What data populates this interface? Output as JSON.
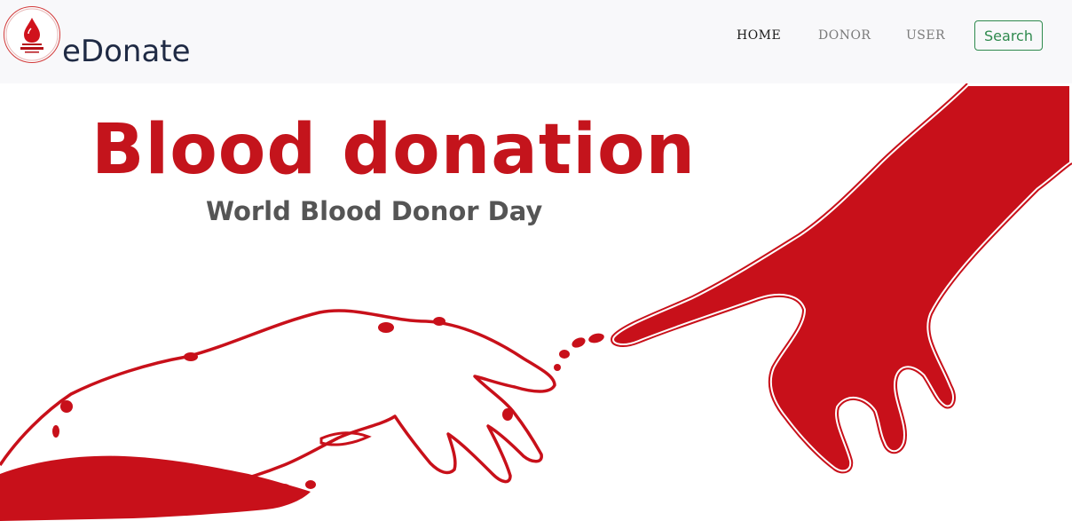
{
  "brand": {
    "name": "eDonate",
    "logo_icon": "blood-drop-logo-icon"
  },
  "nav": {
    "items": [
      {
        "label": "HOME",
        "active": true
      },
      {
        "label": "DONOR",
        "active": false
      },
      {
        "label": "USER",
        "active": false
      }
    ],
    "search_label": "Search"
  },
  "hero": {
    "title": "Blood donation",
    "subtitle": "World Blood Donor Day"
  },
  "colors": {
    "accent_red": "#c4141c",
    "search_green": "#2f8a4e",
    "nav_bg": "#f8f8fa",
    "brand_text": "#1f2a44"
  }
}
